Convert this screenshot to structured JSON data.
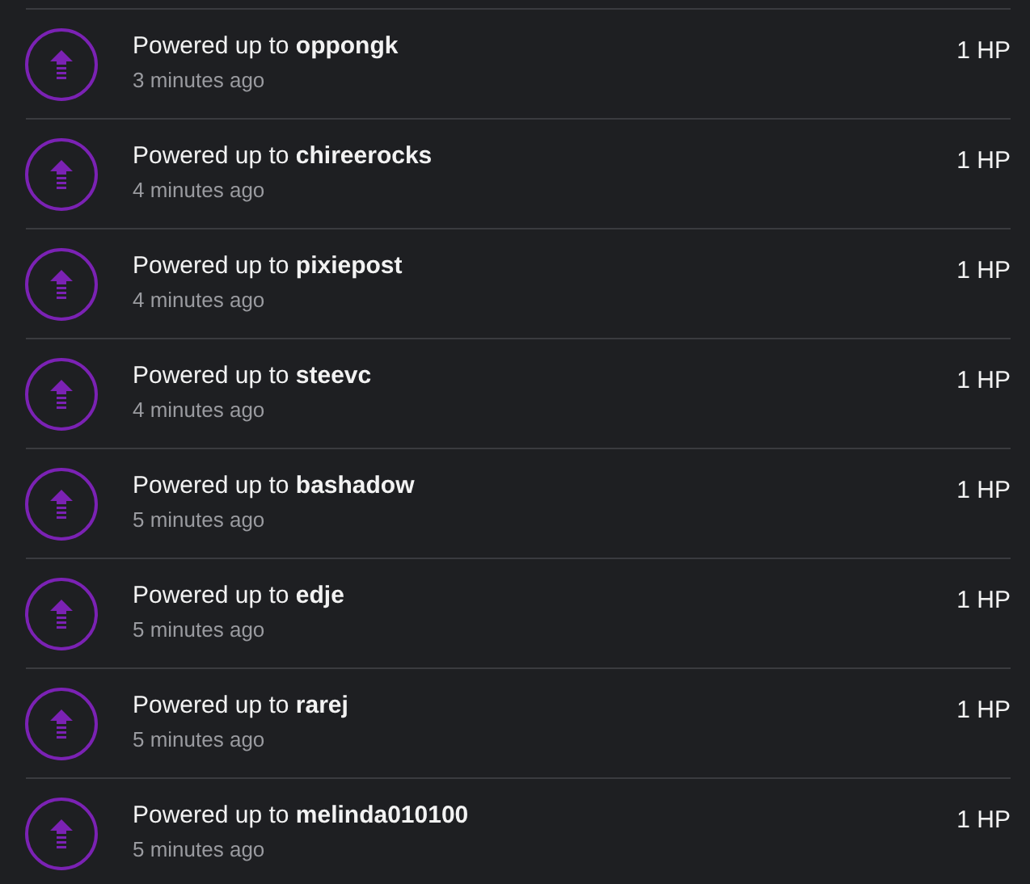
{
  "activities": [
    {
      "message": "Powered up to **oppongk**",
      "time": "3 minutes ago",
      "amount": "1 HP"
    },
    {
      "message": "Powered up to **chireerocks**",
      "time": "4 minutes ago",
      "amount": "1 HP"
    },
    {
      "message": "Powered up to **pixiepost**",
      "time": "4 minutes ago",
      "amount": "1 HP"
    },
    {
      "message": "Powered up to **steevc**",
      "time": "4 minutes ago",
      "amount": "1 HP"
    },
    {
      "message": "Powered up to **bashadow**",
      "time": "5 minutes ago",
      "amount": "1 HP"
    },
    {
      "message": "Powered up to **edje**",
      "time": "5 minutes ago",
      "amount": "1 HP"
    },
    {
      "message": "Powered up to **rarej**",
      "time": "5 minutes ago",
      "amount": "1 HP"
    },
    {
      "message": "Powered up to **melinda010100**",
      "time": "5 minutes ago",
      "amount": "1 HP"
    }
  ]
}
